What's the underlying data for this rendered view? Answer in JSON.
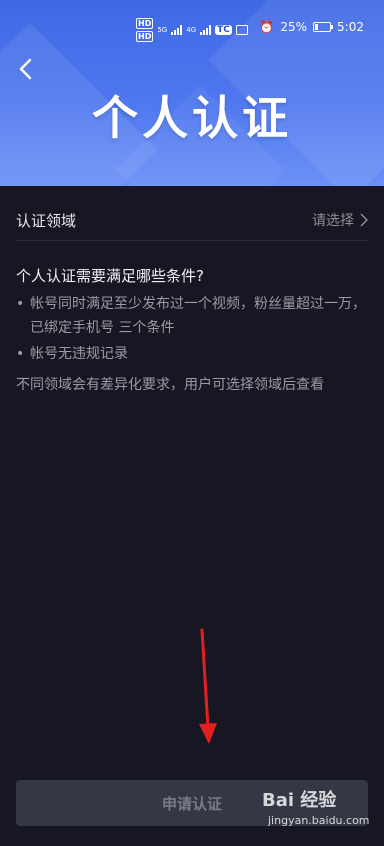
{
  "statusbar": {
    "hd1": "HD",
    "hd2": "HD",
    "net1": "5G",
    "net2": "4G",
    "app_badge": "TC",
    "battery": "25%",
    "time": "5:02"
  },
  "header": {
    "title": "个人认证"
  },
  "field": {
    "label": "认证领域",
    "value": "请选择"
  },
  "conditions": {
    "title": "个人认证需要满足哪些条件?",
    "items": [
      "帐号同时满足至少发布过一个视频，粉丝量超过一万，已绑定手机号 三个条件",
      "帐号无违规记录"
    ],
    "note": "不同领域会有差异化要求，用户可选择领域后查看"
  },
  "submit_label": "申请认证",
  "watermark": {
    "brand": "Bai 经验",
    "url": "jingyan.baidu.com"
  },
  "colors": {
    "header": "#4f78ef",
    "background": "#161722",
    "button": "#363744",
    "arrow": "#e01f1f"
  }
}
